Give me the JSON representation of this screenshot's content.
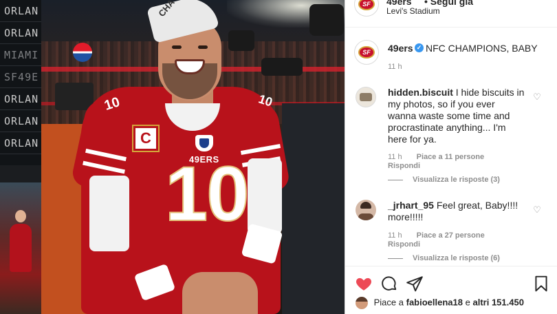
{
  "background": {
    "board_rows": [
      "ORLAN",
      "ORLAN",
      "MIAMI",
      "SF49E",
      "ORLAN",
      "ORLAN",
      "ORLAN"
    ]
  },
  "photo": {
    "jersey_number": "10",
    "shoulder_number": "10",
    "wordmark": "49ERS",
    "captain_patch": "C",
    "cap_text": "CHA",
    "colors": {
      "jersey": "#b8121b",
      "gold": "#d4a63a"
    }
  },
  "header": {
    "username": "49ers",
    "follow_label": "• Segui già",
    "location": "Levi's Stadium"
  },
  "caption": {
    "username": "49ers",
    "verified_icon": "verified-badge-icon",
    "text": "NFC CHAMPIONS, BABY",
    "time": "11 h"
  },
  "comments": [
    {
      "username": "hidden.biscuit",
      "text": "I hide biscuits in my photos, so if you ever wanna waste some time and procrastinate anything... I'm here for ya.",
      "time": "11 h",
      "likes": "Piace a 11 persone",
      "reply": "Rispondi",
      "view_replies": "Visualizza le risposte (3)"
    },
    {
      "username": "_jrhart_95",
      "text": "Feel great, Baby!!!! more!!!!!",
      "time": "11 h",
      "likes": "Piace a 27 persone",
      "reply": "Rispondi",
      "view_replies": "Visualizza le risposte (6)"
    }
  ],
  "actions": {
    "like_icon": "heart-filled-icon",
    "comment_icon": "comment-bubble-icon",
    "share_icon": "paper-plane-icon",
    "save_icon": "bookmark-icon",
    "likes_prefix": "Piace a",
    "likes_user": "fabioellena18",
    "likes_joiner": "e",
    "likes_others": "altri 151.450",
    "like_color": "#ed4956"
  }
}
